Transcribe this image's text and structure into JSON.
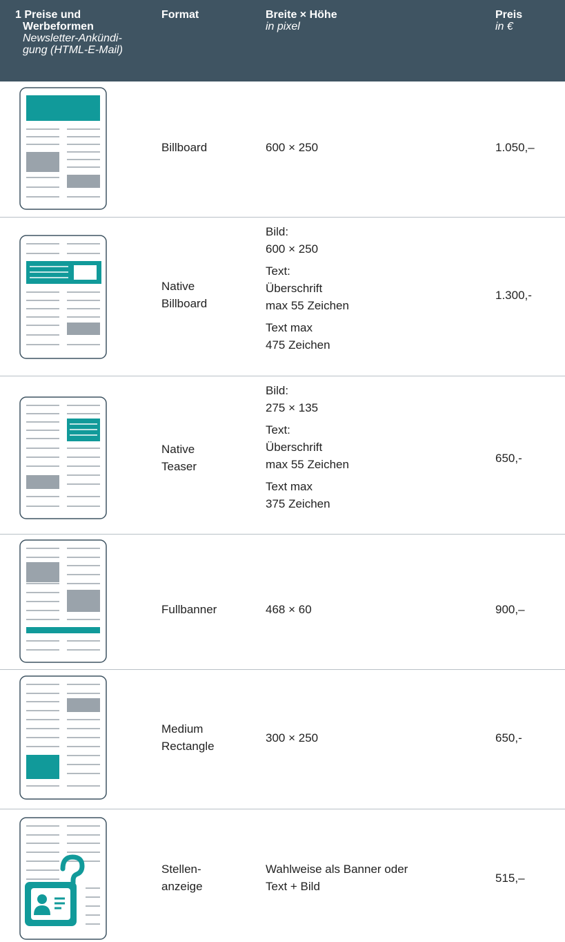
{
  "header": {
    "col1_title_1": "1 Preise und",
    "col1_title_2": "Werbeformen",
    "col1_sub_1": "Newsletter-Ankündi-",
    "col1_sub_2": "gung (HTML-E-Mail)",
    "col2_title": "Format",
    "col3_title": "Breite × Höhe",
    "col3_sub": "in pixel",
    "col4_title": "Preis",
    "col4_sub": "in €"
  },
  "rows": [
    {
      "format_1": "Billboard",
      "dim_1": "600 × 250",
      "price": "1.050,–"
    },
    {
      "format_1": "Native",
      "format_2": "Billboard",
      "dim_1": "Bild:",
      "dim_2": "600 × 250",
      "dim_3": "Text:",
      "dim_4": "Überschrift",
      "dim_5": "max 55 Zeichen",
      "dim_6": "Text max",
      "dim_7": "475 Zeichen",
      "price": "1.300,-"
    },
    {
      "format_1": "Native",
      "format_2": "Teaser",
      "dim_1": "Bild:",
      "dim_2": "275 × 135",
      "dim_3": "Text:",
      "dim_4": "Überschrift",
      "dim_5": "max 55 Zeichen",
      "dim_6": "Text max",
      "dim_7": "375 Zeichen",
      "price": "650,-"
    },
    {
      "format_1": "Fullbanner",
      "dim_1": "468 × 60",
      "price": "900,–"
    },
    {
      "format_1": "Medium",
      "format_2": "Rectangle",
      "dim_1": "300 × 250",
      "price": "650,-"
    },
    {
      "format_1": "Stellen-",
      "format_2": "anzeige",
      "dim_1": "Wahlweise als Banner oder",
      "dim_2": "Text + Bild",
      "price": "515,–"
    }
  ],
  "colors": {
    "header_bg": "#3f5462",
    "accent": "#119a9a",
    "placeholder": "#9aa3ab",
    "line": "#3f5462"
  },
  "icons": [
    "billboard-layout-icon",
    "native-billboard-layout-icon",
    "native-teaser-layout-icon",
    "fullbanner-layout-icon",
    "medium-rectangle-layout-icon",
    "job-ad-layout-icon"
  ]
}
